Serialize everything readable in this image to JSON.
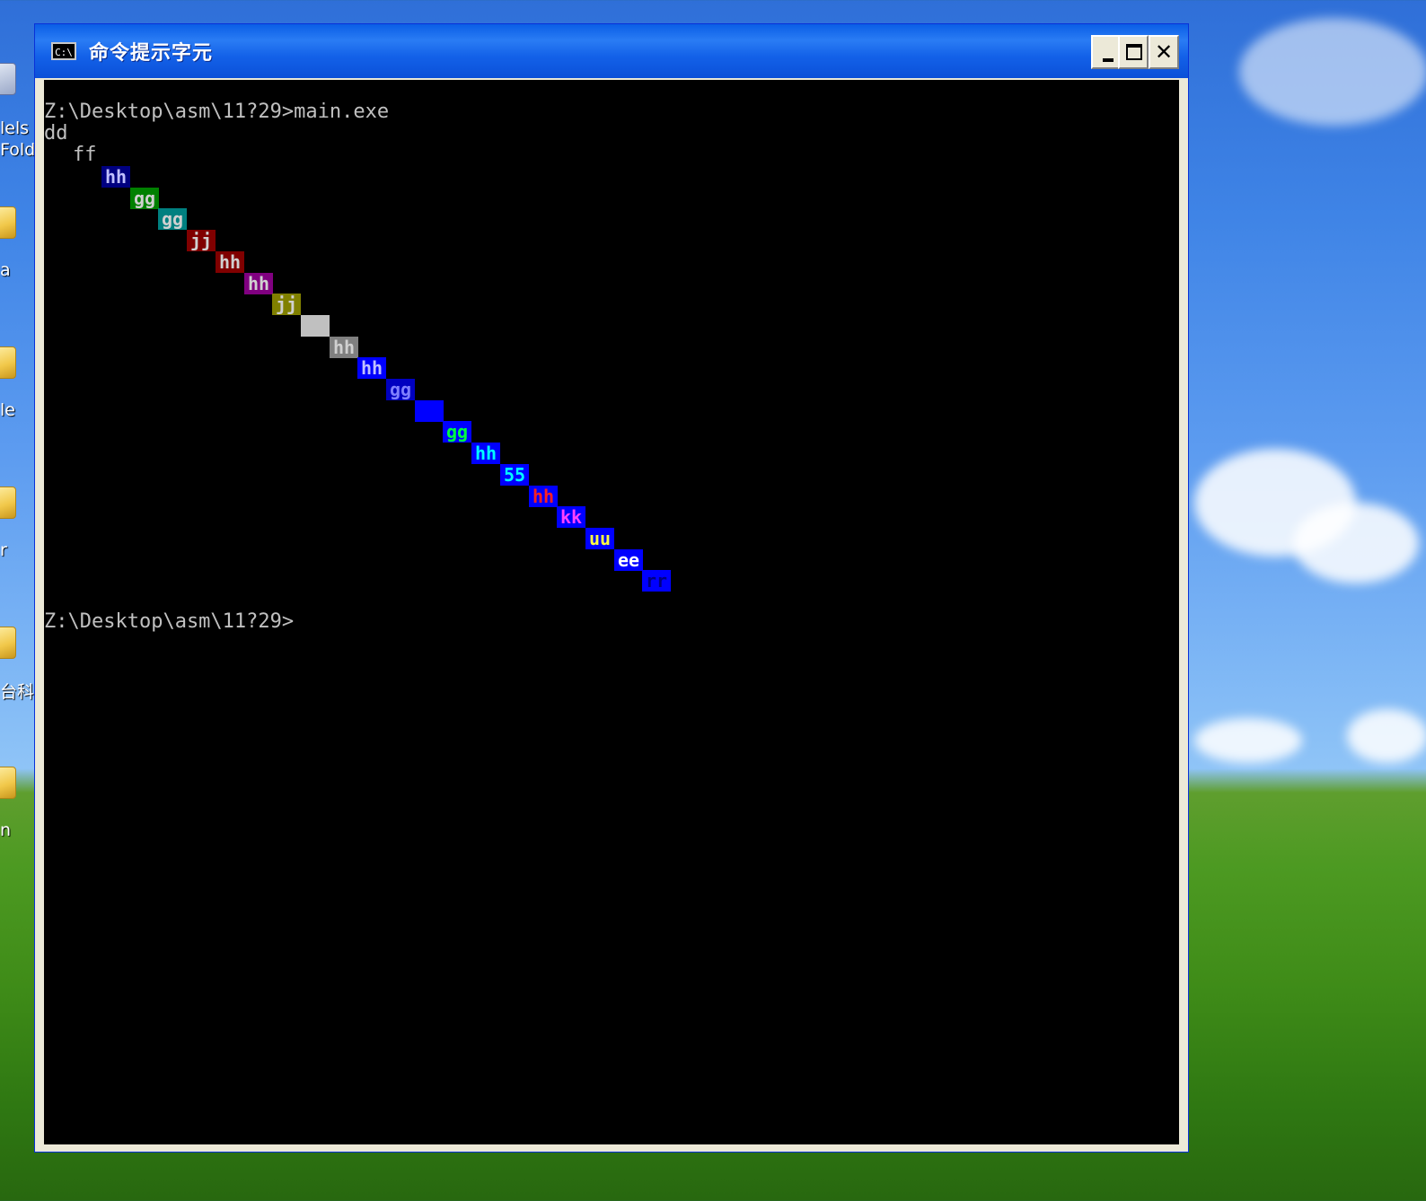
{
  "desktop": {
    "labels": [
      "lels",
      "Folde",
      "a",
      "le",
      "r",
      "台科",
      "n"
    ]
  },
  "window": {
    "title": "命令提示字元",
    "icon_label": "C:\\",
    "buttons": {
      "minimize": "minimize",
      "maximize": "maximize",
      "close": "✕"
    }
  },
  "console": {
    "prompt_command": "Z:\\Desktop\\asm\\11?29>main.exe",
    "line_dd": "dd",
    "line_ff": "ff",
    "final_prompt": "Z:\\Desktop\\asm\\11?29>",
    "colored_cells": [
      {
        "text": "hh",
        "fg": "#c0c0ff",
        "bg": "#000080"
      },
      {
        "text": "gg",
        "fg": "#d0d0d0",
        "bg": "#008000"
      },
      {
        "text": "gg",
        "fg": "#d0d0d0",
        "bg": "#008080"
      },
      {
        "text": "jj",
        "fg": "#d0d0d0",
        "bg": "#800000"
      },
      {
        "text": "hh",
        "fg": "#d0d0d0",
        "bg": "#800000"
      },
      {
        "text": "hh",
        "fg": "#d0d0d0",
        "bg": "#800080"
      },
      {
        "text": "jj",
        "fg": "#d0d0d0",
        "bg": "#808000"
      },
      {
        "text": "",
        "fg": "#d0d0d0",
        "bg": "#c0c0c0"
      },
      {
        "text": "hh",
        "fg": "#d0d0d0",
        "bg": "#808080"
      },
      {
        "text": "hh",
        "fg": "#c0c0ff",
        "bg": "#0000ff"
      },
      {
        "text": "gg",
        "fg": "#8080ff",
        "bg": "#0000c0"
      },
      {
        "text": "",
        "fg": "#0000ff",
        "bg": "#0000ff"
      },
      {
        "text": "gg",
        "fg": "#00ff40",
        "bg": "#0000ff"
      },
      {
        "text": "hh",
        "fg": "#00ffff",
        "bg": "#0000ff"
      },
      {
        "text": "55",
        "fg": "#00ffff",
        "bg": "#0000ff"
      },
      {
        "text": "hh",
        "fg": "#ff2020",
        "bg": "#0000ff"
      },
      {
        "text": "kk",
        "fg": "#ff40ff",
        "bg": "#0000ff"
      },
      {
        "text": "uu",
        "fg": "#ffff40",
        "bg": "#0000ff"
      },
      {
        "text": "ee",
        "fg": "#ffffff",
        "bg": "#0000ff"
      },
      {
        "text": "rr",
        "fg": "#000080",
        "bg": "#0000ff"
      }
    ]
  }
}
